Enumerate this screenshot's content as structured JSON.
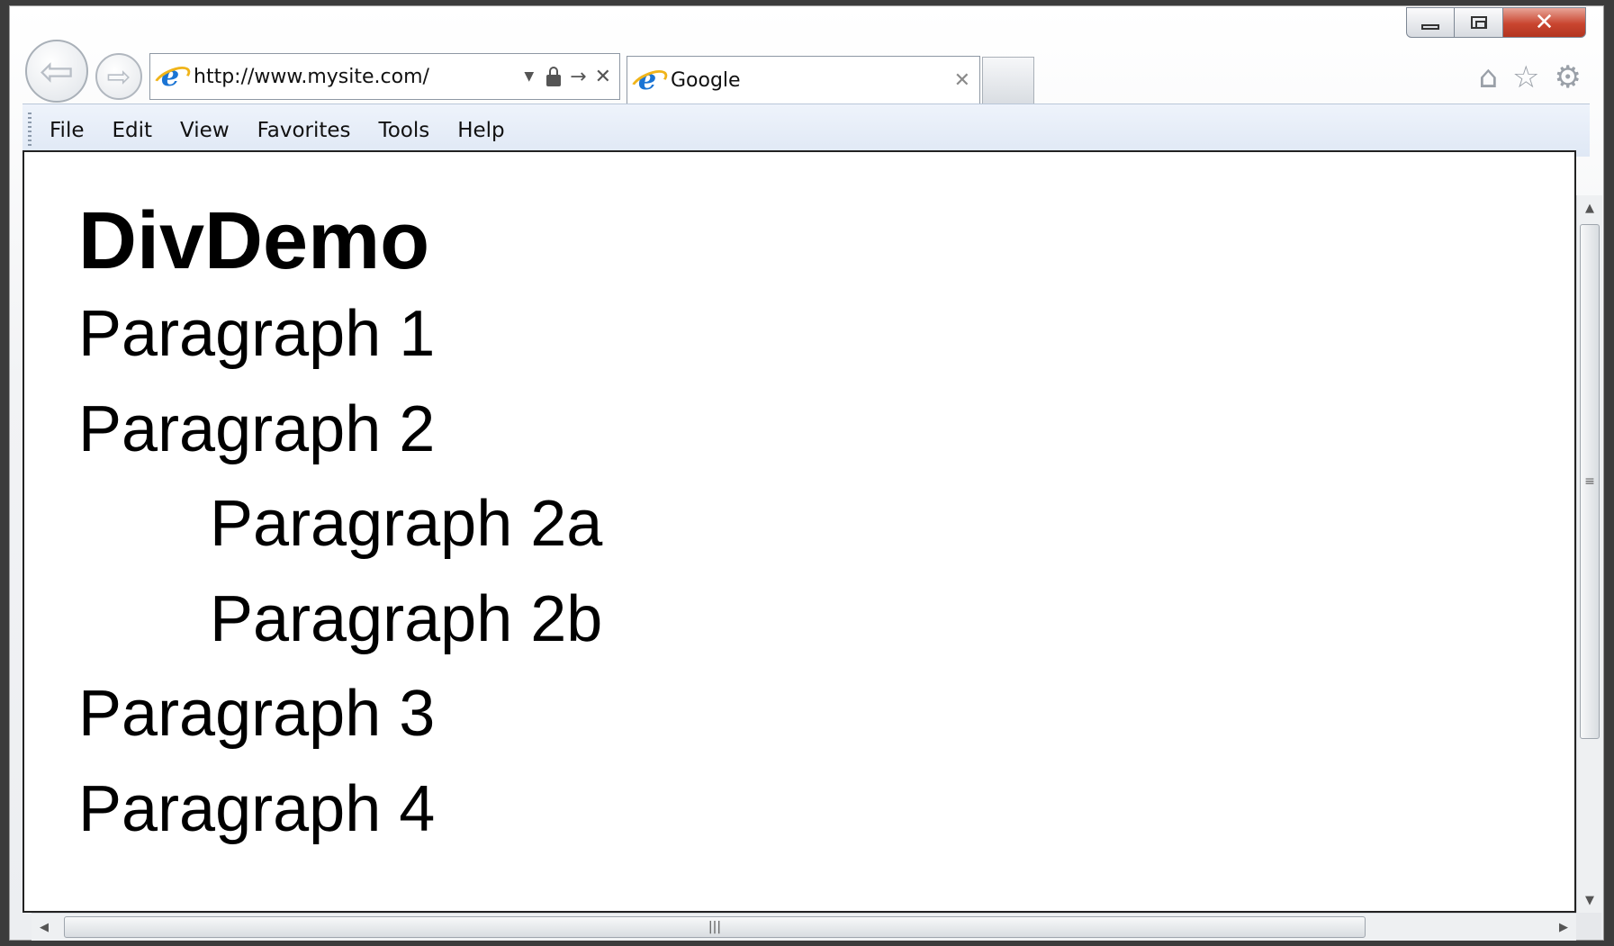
{
  "browser": {
    "address_url": "http://www.mysite.com/",
    "tab_title": "Google",
    "menu": [
      "File",
      "Edit",
      "View",
      "Favorites",
      "Tools",
      "Help"
    ],
    "icons": {
      "back": "back-arrow-icon",
      "forward": "forward-arrow-icon",
      "home": "home-icon",
      "favorites": "star-icon",
      "tools": "gear-icon",
      "close_window": "close-icon"
    },
    "accent_colors": {
      "close_button": "#c9452f",
      "menubar": "#dfe8f5",
      "ie_logo": "#1a74d4"
    }
  },
  "page": {
    "heading": "DivDemo",
    "paragraphs": [
      "Paragraph 1",
      "Paragraph 2",
      "Paragraph 2a",
      "Paragraph 2b",
      "Paragraph 3",
      "Paragraph 4"
    ]
  }
}
